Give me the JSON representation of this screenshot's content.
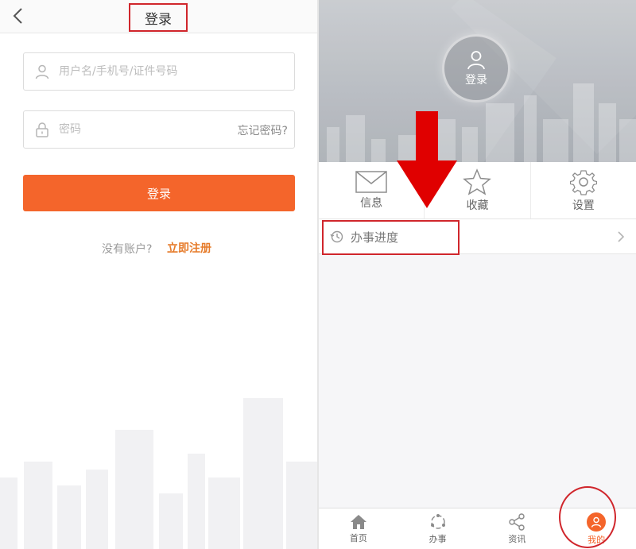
{
  "login": {
    "title": "登录",
    "username_placeholder": "用户名/手机号/证件号码",
    "password_placeholder": "密码",
    "forgot_label": "忘记密码?",
    "login_button": "登录",
    "no_account_text": "没有账户?",
    "register_link": "立即注册"
  },
  "profile": {
    "avatar_label": "登录",
    "menu": [
      {
        "label": "信息",
        "icon": "envelope-icon"
      },
      {
        "label": "收藏",
        "icon": "star-icon"
      },
      {
        "label": "设置",
        "icon": "gear-icon"
      }
    ],
    "progress_label": "办事进度",
    "tabs": [
      {
        "label": "首页",
        "icon": "home-icon"
      },
      {
        "label": "办事",
        "icon": "services-icon"
      },
      {
        "label": "资讯",
        "icon": "share-icon"
      },
      {
        "label": "我的",
        "icon": "user-icon"
      }
    ]
  },
  "colors": {
    "accent": "#f4652b",
    "annotation_red": "#d0262c",
    "register_link": "#e67b2a"
  }
}
